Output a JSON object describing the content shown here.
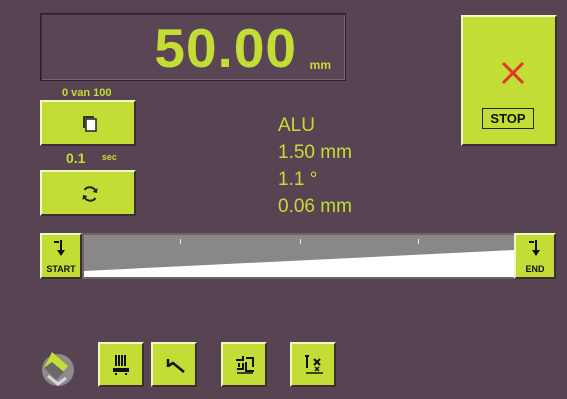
{
  "display": {
    "value": "50.00",
    "unit": "mm"
  },
  "stop": {
    "label": "STOP"
  },
  "counter": {
    "text": "0 van 100"
  },
  "timer": {
    "value": "0.1",
    "unit": "sec"
  },
  "material": {
    "name": "ALU",
    "thickness": "1.50 mm",
    "angle": "1.1 °",
    "tolerance": "0.06 mm"
  },
  "bar": {
    "start_label": "START",
    "end_label": "END"
  },
  "toolbar": {
    "icons": [
      "press-tool-icon",
      "bend-angle-icon",
      "back-gauge-icon",
      "axis-x-icon"
    ]
  },
  "colors": {
    "background": "#584353",
    "accent": "#c3dd36",
    "stop_x": "#e0362b"
  }
}
